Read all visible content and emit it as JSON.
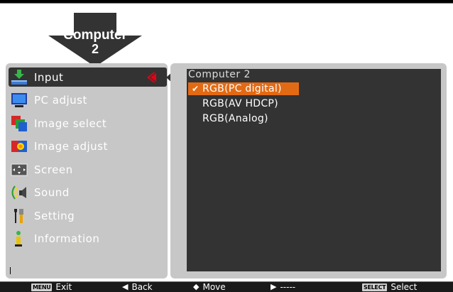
{
  "header": {
    "arrow_label_line1": "Computer",
    "arrow_label_line2": "2"
  },
  "menu": {
    "items": [
      {
        "label": "Input",
        "icon": "input-icon",
        "selected": true
      },
      {
        "label": "PC adjust",
        "icon": "monitor-icon"
      },
      {
        "label": "Image select",
        "icon": "image-select-icon"
      },
      {
        "label": "Image adjust",
        "icon": "image-adjust-icon"
      },
      {
        "label": "Screen",
        "icon": "screen-icon"
      },
      {
        "label": "Sound",
        "icon": "speaker-icon"
      },
      {
        "label": "Setting",
        "icon": "tools-icon"
      },
      {
        "label": "Information",
        "icon": "info-icon"
      }
    ]
  },
  "submenu": {
    "title": "Computer 2",
    "options": [
      {
        "label": "RGB(PC digital)",
        "checked": true
      },
      {
        "label": "RGB(AV HDCP)"
      },
      {
        "label": "RGB(Analog)"
      }
    ]
  },
  "footer": {
    "exit_key": "MENU",
    "exit_label": "Exit",
    "back_label": "Back",
    "move_label": "Move",
    "next_label": "-----",
    "select_key": "SELECT",
    "select_label": "Select"
  },
  "colors": {
    "selection_accent": "#e36a14",
    "panel_bg": "#c7c7c7",
    "panel_dark": "#333333",
    "chevron_red": "#e60012"
  }
}
